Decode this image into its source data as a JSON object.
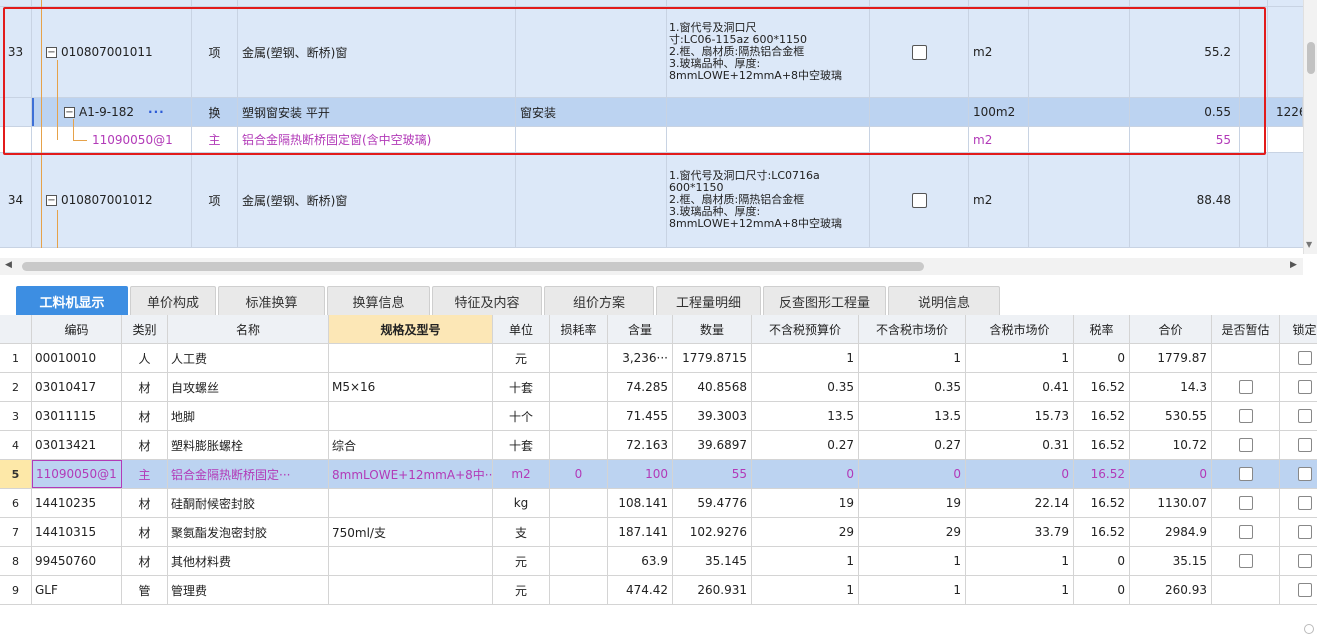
{
  "upper": {
    "rows": [
      {
        "num": "33",
        "code": "010807001011",
        "type": "项",
        "name": "金属(塑钢、断桥)窗",
        "feature_lines": [
          "1.窗代号及洞口尺",
          "寸:LC06-115az 600*1150",
          "2.框、扇材质:隔热铝合金框",
          "3.玻璃品种、厚度:",
          "8mmLOWE+12mmA+8中空玻璃"
        ],
        "unit": "m2",
        "qty": "55.2"
      },
      {
        "code": "A1-9-182",
        "ellipsis": "···",
        "type": "换",
        "name": "塑钢窗安装 平开",
        "category": "窗安装",
        "unit": "100m2",
        "qty": "0.55",
        "extra": "1226"
      },
      {
        "code": "11090050@1",
        "type": "主",
        "name": "铝合金隔热断桥固定窗(含中空玻璃)",
        "unit": "m2",
        "qty": "55"
      },
      {
        "num": "34",
        "code": "010807001012",
        "type": "项",
        "name": "金属(塑钢、断桥)窗",
        "feature_lines": [
          "1.窗代号及洞口尺寸:LC0716a",
          "600*1150",
          "2.框、扇材质:隔热铝合金框",
          "3.玻璃品种、厚度:",
          "8mmLOWE+12mmA+8中空玻璃"
        ],
        "unit": "m2",
        "qty": "88.48"
      }
    ]
  },
  "tabs": [
    "工料机显示",
    "单价构成",
    "标准换算",
    "换算信息",
    "特征及内容",
    "组价方案",
    "工程量明细",
    "反查图形工程量",
    "说明信息"
  ],
  "lower": {
    "headers": [
      "编码",
      "类别",
      "名称",
      "规格及型号",
      "单位",
      "损耗率",
      "含量",
      "数量",
      "不含税预算价",
      "不含税市场价",
      "含税市场价",
      "税率",
      "合价",
      "是否暂估",
      "锁定"
    ],
    "rows": [
      {
        "n": "1",
        "code": "00010010",
        "cat": "人",
        "name": "人工费",
        "spec": "",
        "unit": "元",
        "loss": "",
        "content": "3,236···",
        "qty": "1779.8715",
        "p1": "1",
        "p2": "1",
        "p3": "1",
        "tax": "0",
        "total": "1779.87",
        "est": false
      },
      {
        "n": "2",
        "code": "03010417",
        "cat": "材",
        "name": "自攻螺丝",
        "spec": "M5×16",
        "unit": "十套",
        "loss": "",
        "content": "74.285",
        "qty": "40.8568",
        "p1": "0.35",
        "p2": "0.35",
        "p3": "0.41",
        "tax": "16.52",
        "total": "14.3",
        "est": true
      },
      {
        "n": "3",
        "code": "03011115",
        "cat": "材",
        "name": "地脚",
        "spec": "",
        "unit": "十个",
        "loss": "",
        "content": "71.455",
        "qty": "39.3003",
        "p1": "13.5",
        "p2": "13.5",
        "p3": "15.73",
        "tax": "16.52",
        "total": "530.55",
        "est": true
      },
      {
        "n": "4",
        "code": "03013421",
        "cat": "材",
        "name": "塑料膨胀螺栓",
        "spec": "综合",
        "unit": "十套",
        "loss": "",
        "content": "72.163",
        "qty": "39.6897",
        "p1": "0.27",
        "p2": "0.27",
        "p3": "0.31",
        "tax": "16.52",
        "total": "10.72",
        "est": true
      },
      {
        "n": "5",
        "code": "11090050@1",
        "cat": "主",
        "name": "铝合金隔热断桥固定···",
        "spec": "8mmLOWE+12mmA+8中···",
        "unit": "m2",
        "loss": "0",
        "content": "100",
        "qty": "55",
        "p1": "0",
        "p2": "0",
        "p3": "0",
        "tax": "16.52",
        "total": "0",
        "est": true
      },
      {
        "n": "6",
        "code": "14410235",
        "cat": "材",
        "name": "硅酮耐候密封胶",
        "spec": "",
        "unit": "kg",
        "loss": "",
        "content": "108.141",
        "qty": "59.4776",
        "p1": "19",
        "p2": "19",
        "p3": "22.14",
        "tax": "16.52",
        "total": "1130.07",
        "est": true
      },
      {
        "n": "7",
        "code": "14410315",
        "cat": "材",
        "name": "聚氨酯发泡密封胶",
        "spec": "750ml/支",
        "unit": "支",
        "loss": "",
        "content": "187.141",
        "qty": "102.9276",
        "p1": "29",
        "p2": "29",
        "p3": "33.79",
        "tax": "16.52",
        "total": "2984.9",
        "est": true
      },
      {
        "n": "8",
        "code": "99450760",
        "cat": "材",
        "name": "其他材料费",
        "spec": "",
        "unit": "元",
        "loss": "",
        "content": "63.9",
        "qty": "35.145",
        "p1": "1",
        "p2": "1",
        "p3": "1",
        "tax": "0",
        "total": "35.15",
        "est": true
      },
      {
        "n": "9",
        "code": "GLF",
        "cat": "管",
        "name": "管理费",
        "spec": "",
        "unit": "元",
        "loss": "",
        "content": "474.42",
        "qty": "260.931",
        "p1": "1",
        "p2": "1",
        "p3": "1",
        "tax": "0",
        "total": "260.93",
        "est": false
      }
    ]
  }
}
